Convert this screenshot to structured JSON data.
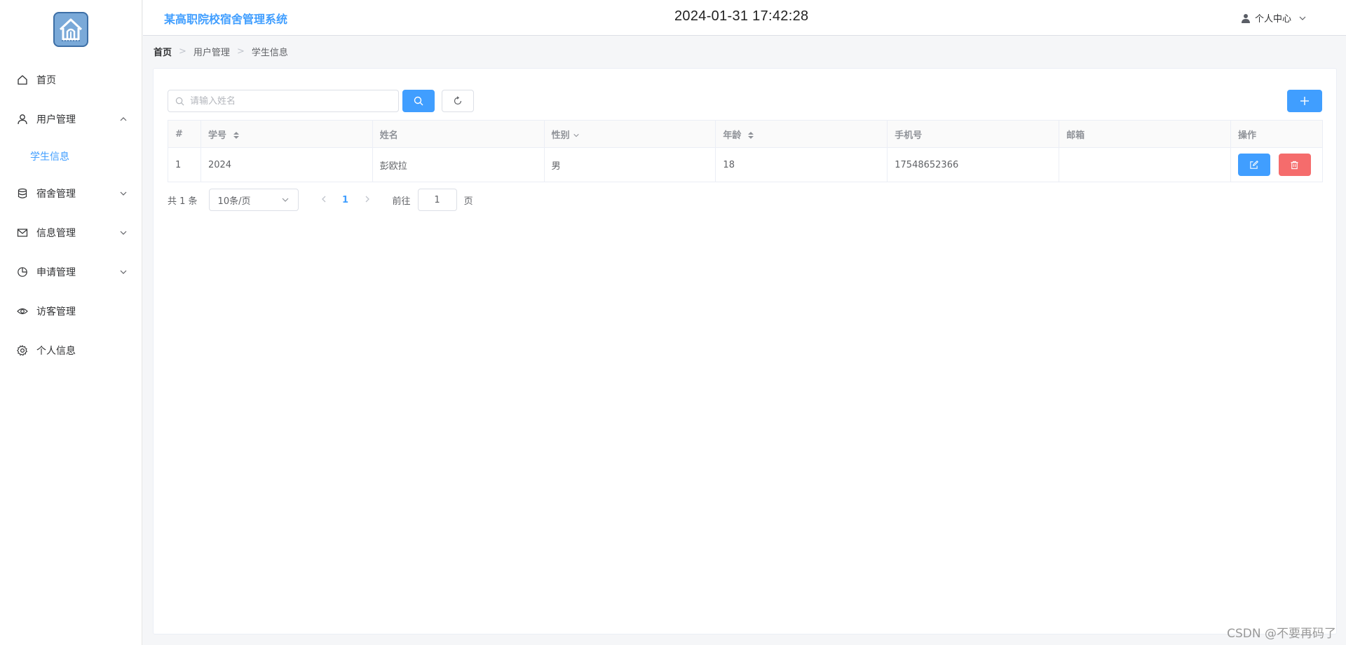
{
  "header": {
    "title": "某高职院校宿舍管理系统",
    "clock": "2024-01-31 17:42:28",
    "user_center": "个人中心"
  },
  "sidebar": {
    "items": [
      {
        "label": "首页",
        "icon": "home-icon"
      },
      {
        "label": "用户管理",
        "icon": "user-icon",
        "expanded": true,
        "children": [
          {
            "label": "学生信息",
            "active": true
          }
        ]
      },
      {
        "label": "宿舍管理",
        "icon": "database-icon"
      },
      {
        "label": "信息管理",
        "icon": "message-icon"
      },
      {
        "label": "申请管理",
        "icon": "pie-chart-icon"
      },
      {
        "label": "访客管理",
        "icon": "eye-icon"
      },
      {
        "label": "个人信息",
        "icon": "gear-icon"
      }
    ]
  },
  "breadcrumb": [
    "首页",
    "用户管理",
    "学生信息"
  ],
  "search": {
    "placeholder": "请输入姓名",
    "value": ""
  },
  "table": {
    "columns": [
      "#",
      "学号",
      "姓名",
      "性别",
      "年龄",
      "手机号",
      "邮箱",
      "操作"
    ],
    "rows": [
      {
        "index": "1",
        "student_id": "2024",
        "name": "彭欧拉",
        "gender": "男",
        "age": "18",
        "phone": "17548652366",
        "email": ""
      }
    ]
  },
  "pagination": {
    "total": "共 1 条",
    "page_size": "10条/页",
    "current_page": "1",
    "goto_label": "前往",
    "goto_value": "1",
    "page_unit": "页"
  },
  "watermark": "CSDN @不要再码了",
  "colors": {
    "primary": "#409eff",
    "danger": "#f56c6c",
    "border": "#ebeef5"
  }
}
